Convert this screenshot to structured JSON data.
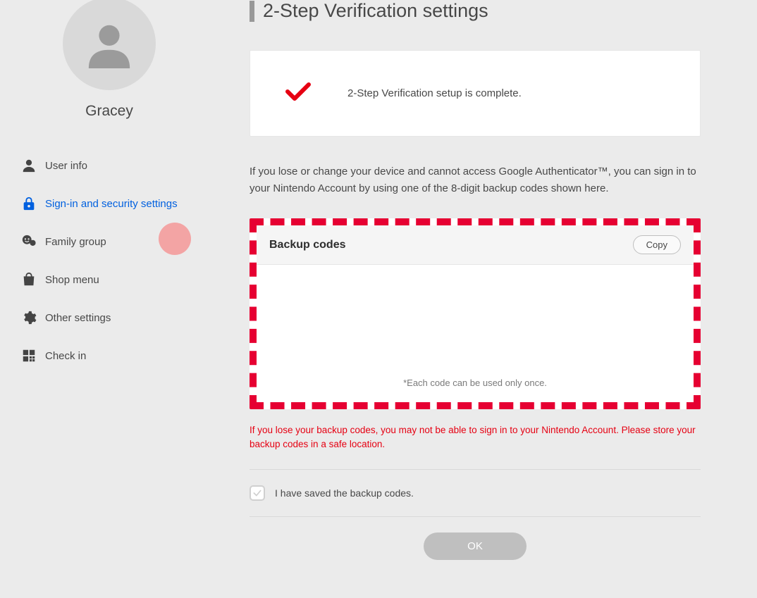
{
  "profile": {
    "username": "Gracey"
  },
  "sidebar": {
    "items": [
      {
        "label": "User info"
      },
      {
        "label": "Sign-in and security settings"
      },
      {
        "label": "Family group"
      },
      {
        "label": "Shop menu"
      },
      {
        "label": "Other settings"
      },
      {
        "label": "Check in"
      }
    ]
  },
  "main": {
    "title": "2-Step Verification settings",
    "status_text": "2-Step Verification setup is complete.",
    "description": "If you lose or change your device and cannot access Google Authenticator™, you can sign in to your Nintendo Account by using one of the 8-digit backup codes shown here.",
    "backup": {
      "title": "Backup codes",
      "copy_label": "Copy",
      "note": "*Each code can be used only once."
    },
    "warning": "If you lose your backup codes, you may not be able to sign in to your Nintendo Account. Please store your backup codes in a safe location.",
    "checkbox_label": "I have saved the backup codes.",
    "ok_label": "OK"
  }
}
